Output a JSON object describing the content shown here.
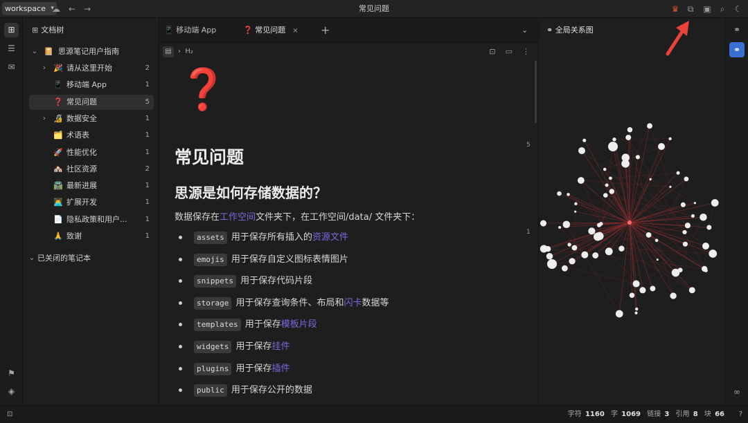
{
  "titlebar": {
    "workspace": "workspace",
    "title": "常见问题"
  },
  "filetree": {
    "header": "文档树",
    "notebook": "思源笔记用户指南",
    "items": [
      {
        "emoji": "🎉",
        "label": "请从这里开始",
        "count": "2",
        "has_children": true
      },
      {
        "emoji": "📱",
        "label": "移动端 App",
        "count": "1",
        "has_children": false
      },
      {
        "emoji": "❓",
        "label": "常见问题",
        "count": "5",
        "has_children": false,
        "selected": true
      },
      {
        "emoji": "🔏",
        "label": "数据安全",
        "count": "1",
        "has_children": true
      },
      {
        "emoji": "🗂️",
        "label": "术语表",
        "count": "1",
        "has_children": false
      },
      {
        "emoji": "🚀",
        "label": "性能优化",
        "count": "1",
        "has_children": false
      },
      {
        "emoji": "🏘️",
        "label": "社区资源",
        "count": "2",
        "has_children": false
      },
      {
        "emoji": "🛣️",
        "label": "最新进展",
        "count": "1",
        "has_children": false
      },
      {
        "emoji": "👨‍💻",
        "label": "扩展开发",
        "count": "1",
        "has_children": false
      },
      {
        "emoji": "📄",
        "label": "隐私政策和用户...",
        "count": "1",
        "has_children": false
      },
      {
        "emoji": "🙏",
        "label": "致谢",
        "count": "1",
        "has_children": false
      }
    ],
    "closed_notebooks": "已关闭的笔记本"
  },
  "tabs": [
    {
      "icon": "📱",
      "label": "移动端 App"
    },
    {
      "icon": "❓",
      "label": "常见问题",
      "active": true
    }
  ],
  "breadcrumb": {
    "heading": "H₂"
  },
  "doc": {
    "icon": "❓",
    "title": "常见问题",
    "h2": "思源是如何存储数据的？",
    "para_before": "数据保存在",
    "para_link": "工作空间",
    "para_after": "文件夹下，在工作空间/data/ 文件夹下：",
    "items": [
      {
        "code": "assets",
        "text": "用于保存所有插入的",
        "link": "资源文件",
        "tail": ""
      },
      {
        "code": "emojis",
        "text": "用于保存自定义图标表情图片",
        "link": "",
        "tail": ""
      },
      {
        "code": "snippets",
        "text": "用于保存代码片段",
        "link": "",
        "tail": ""
      },
      {
        "code": "storage",
        "text": "用于保存查询条件、布局和",
        "link": "闪卡",
        "tail": "数据等"
      },
      {
        "code": "templates",
        "text": "用于保存",
        "link": "模板片段",
        "tail": ""
      },
      {
        "code": "widgets",
        "text": "用于保存",
        "link": "挂件",
        "tail": ""
      },
      {
        "code": "plugins",
        "text": "用于保存",
        "link": "插件",
        "tail": ""
      },
      {
        "code": "public",
        "text": "用于保存公开的数据",
        "link": "",
        "tail": ""
      }
    ],
    "block_counts": [
      "5",
      "1"
    ]
  },
  "graph": {
    "title": "全局关系图"
  },
  "status": {
    "chars_label": "字符",
    "chars": "1160",
    "words_label": "字",
    "words": "1069",
    "links_label": "链接",
    "links": "3",
    "refs_label": "引用",
    "refs": "8",
    "blocks_label": "块",
    "blocks": "66"
  },
  "colors": {
    "accent": "#3b6fd4",
    "link": "#7e66e0",
    "annotation": "#e8423a"
  }
}
